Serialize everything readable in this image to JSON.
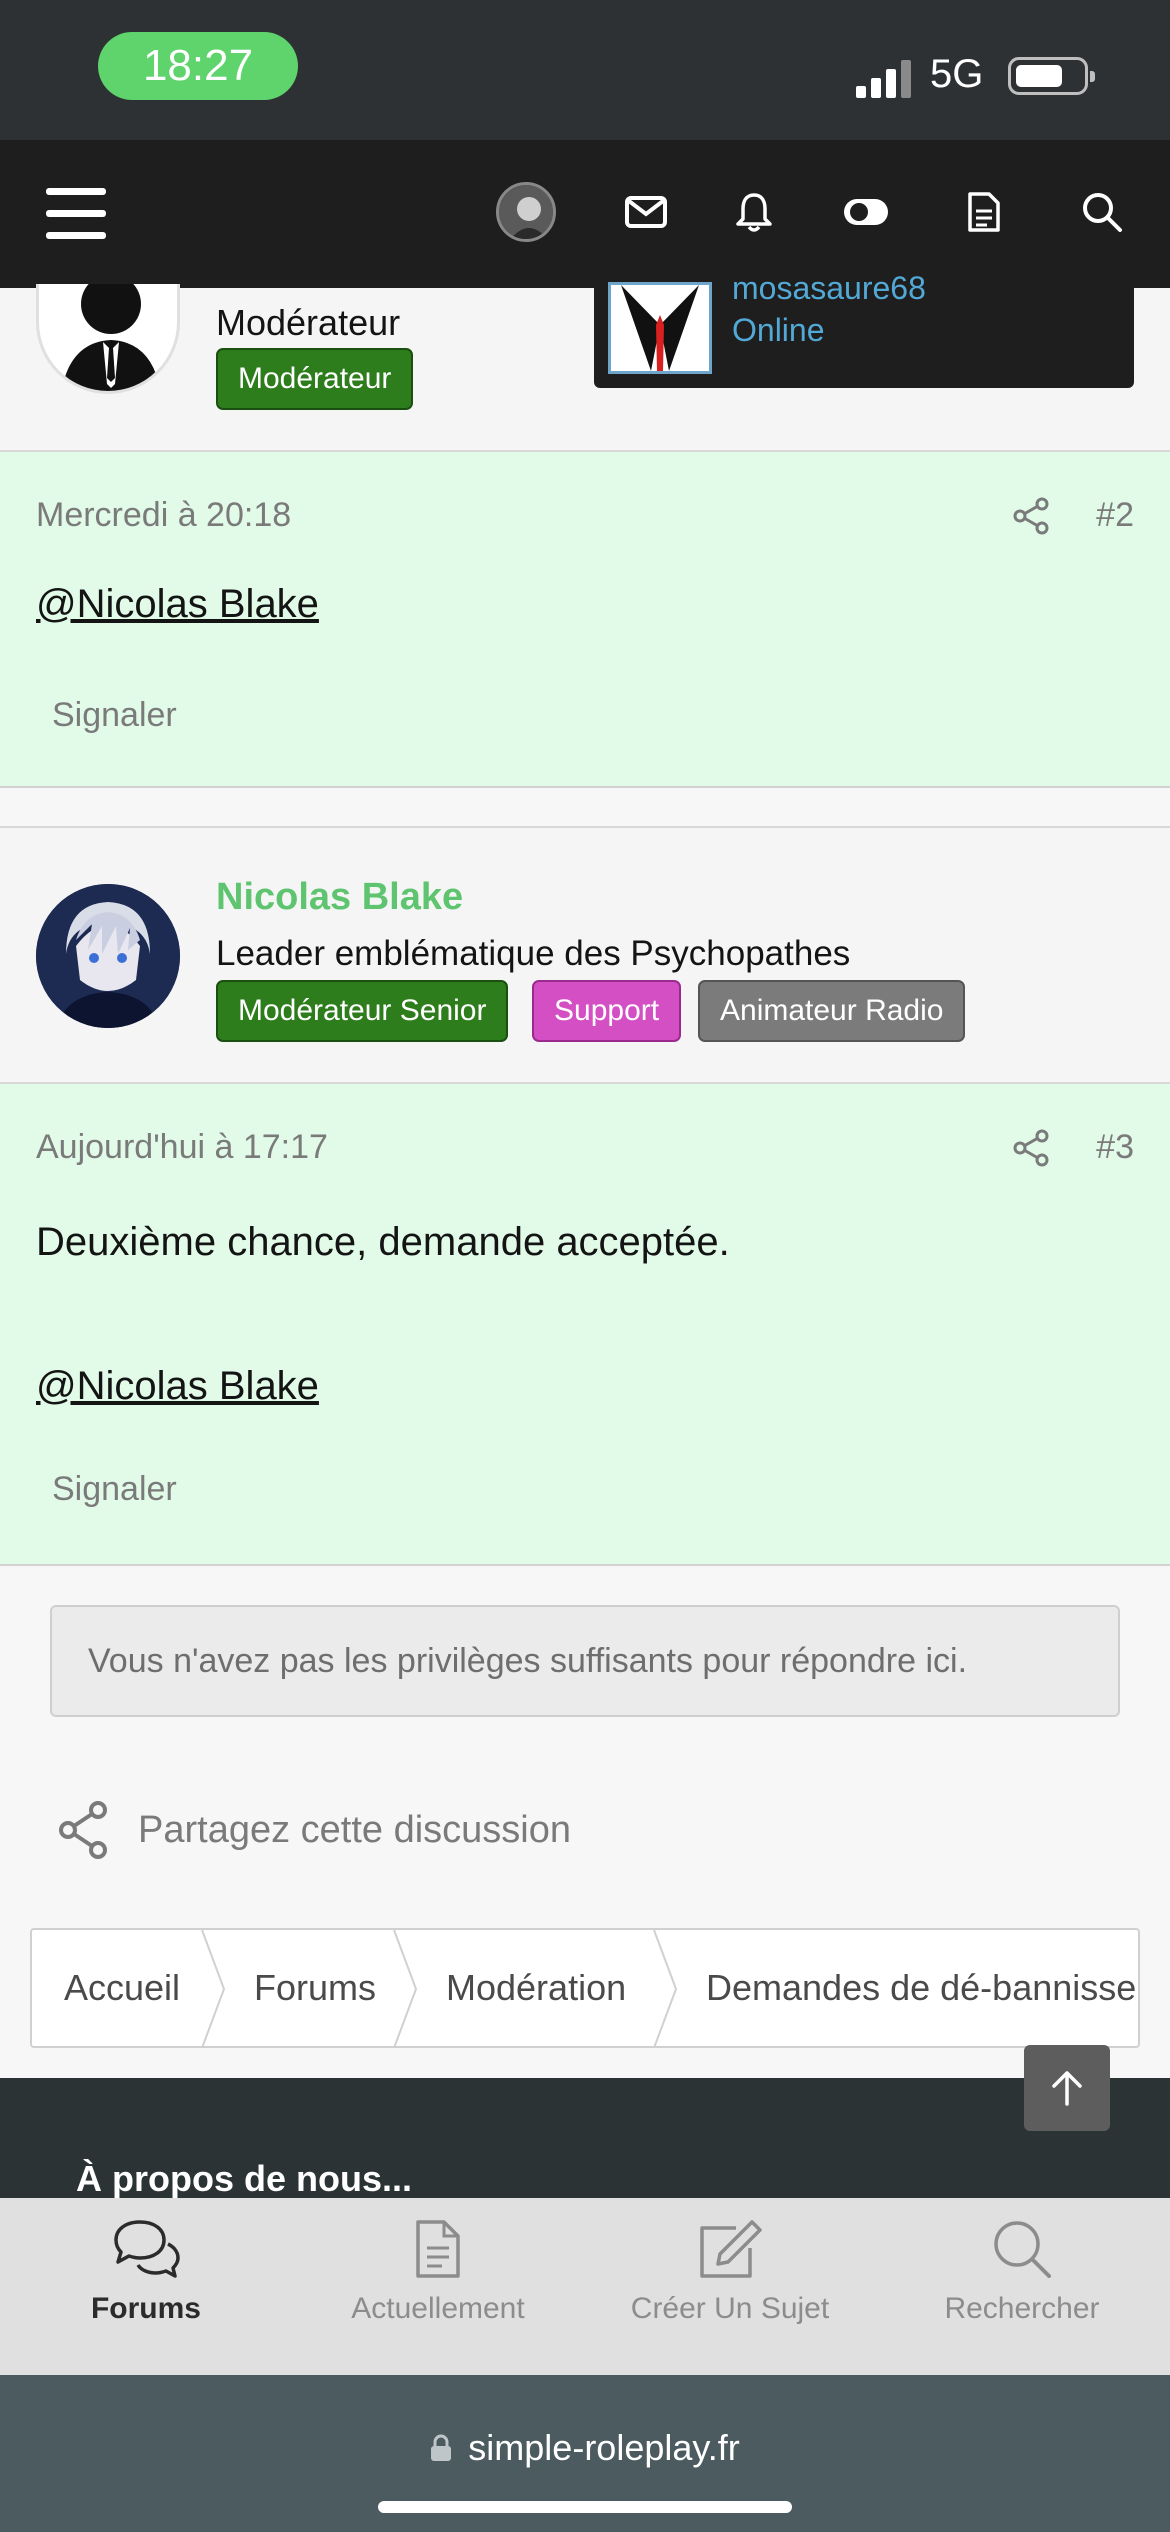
{
  "status_bar": {
    "time": "18:27",
    "network": "5G"
  },
  "navbar": {
    "icons": [
      "menu-icon",
      "avatar",
      "mail-icon",
      "bell-icon",
      "theme-toggle-icon",
      "document-icon",
      "search-icon"
    ]
  },
  "post1_author": {
    "title": "Modérateur",
    "badges": [
      "Modérateur"
    ]
  },
  "user_popup": {
    "name": "mosasaure68",
    "status": "Online"
  },
  "post2": {
    "date": "Mercredi à 20:18",
    "number": "#2",
    "mention": "@Nicolas Blake",
    "report": "Signaler"
  },
  "post3_author": {
    "name": "Nicolas Blake",
    "title": "Leader emblématique des Psychopathes",
    "badges": [
      "Modérateur Senior",
      "Support",
      "Animateur Radio"
    ]
  },
  "post3": {
    "date": "Aujourd'hui à 17:17",
    "number": "#3",
    "text": "Deuxième chance, demande acceptée.",
    "mention": "@Nicolas Blake",
    "report": "Signaler"
  },
  "no_permission": "Vous n'avez pas les privilèges suffisants pour répondre ici.",
  "share_discussion": "Partagez cette discussion",
  "breadcrumbs": [
    "Accueil",
    "Forums",
    "Modération",
    "Demandes de dé-bannissement"
  ],
  "footer": {
    "title": "À propos de nous..."
  },
  "tabbar": {
    "tabs": [
      {
        "label": "Forums",
        "icon": "chat-bubbles-icon",
        "active": true
      },
      {
        "label": "Actuellement",
        "icon": "document-icon",
        "active": false
      },
      {
        "label": "Créer Un Sujet",
        "icon": "edit-icon",
        "active": false
      },
      {
        "label": "Rechercher",
        "icon": "search-icon",
        "active": false
      }
    ]
  },
  "url": "simple-roleplay.fr",
  "colors": {
    "accent_green": "#5fc46f",
    "post_bg": "#e1fbe8",
    "navbar": "#1e1e1e"
  }
}
